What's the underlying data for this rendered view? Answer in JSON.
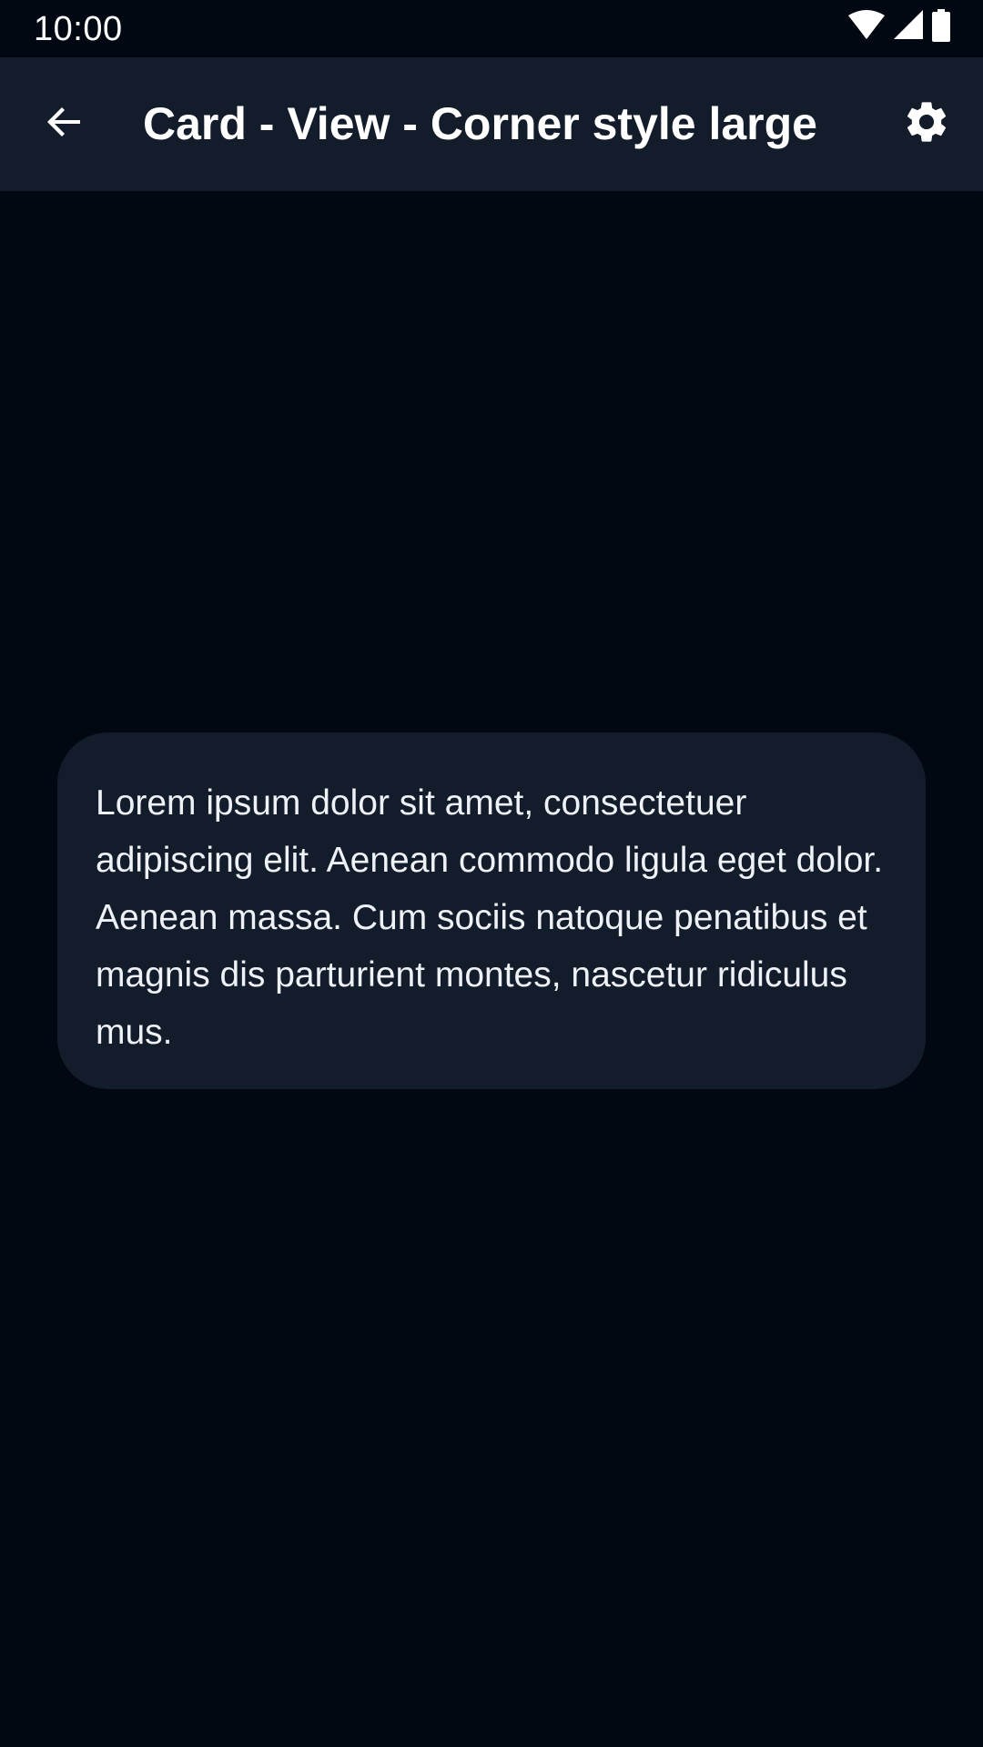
{
  "status_bar": {
    "time": "10:00",
    "icons": [
      "wifi-icon",
      "signal-icon",
      "battery-icon"
    ]
  },
  "app_bar": {
    "title": "Card - View - Corner style large",
    "back_icon": "arrow-back-icon",
    "settings_icon": "gear-icon"
  },
  "card": {
    "text": "Lorem ipsum dolor sit amet, consectetuer adipiscing elit. Aenean commodo ligula eget dolor. Aenean massa. Cum sociis natoque penatibus et magnis dis parturient montes, nascetur ridiculus mus."
  },
  "colors": {
    "background": "#020812",
    "surface": "#131c2a",
    "on_surface": "#ffffff"
  }
}
